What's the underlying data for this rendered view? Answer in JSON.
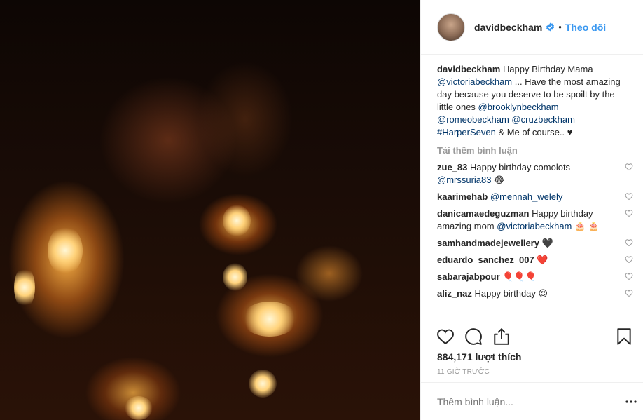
{
  "post": {
    "username": "davidbeckham",
    "follow_label": "Theo dõi",
    "dot": "•"
  },
  "caption": {
    "username": "davidbeckham",
    "text1": " Happy Birthday Mama ",
    "mention1": "@victoriabeckham",
    "text2": " ... Have the most amazing day because you deserve to be spoilt by the little ones ",
    "mention2": "@brooklynbeckham",
    "mention3": "@romeobeckham",
    "mention4": "@cruzbeckham",
    "mention5": "#HarperSeven",
    "text3": " & Me of course.. ♥"
  },
  "load_more_label": "Tải thêm bình luận",
  "comments": [
    {
      "user": "zue_83",
      "text": " Happy birthday comolots ",
      "mention": "@mrssuria83",
      "emoji": "😂"
    },
    {
      "user": "kaarimehab",
      "text": " ",
      "mention": "@mennah_welely",
      "emoji": ""
    },
    {
      "user": "danicamaedeguzman",
      "text": " Happy birthday amazing mom ",
      "mention": "@victoriabeckham",
      "emoji": "🎂 🎂"
    },
    {
      "user": "samhandmadejewellery",
      "text": " ",
      "mention": "",
      "emoji": "🖤"
    },
    {
      "user": "eduardo_sanchez_007",
      "text": " ",
      "mention": "",
      "emoji": "❤️"
    },
    {
      "user": "sabarajabpour",
      "text": " ",
      "mention": "",
      "emoji": "🎈🎈🎈"
    },
    {
      "user": "aliz_naz",
      "text": " Happy birthday ",
      "mention": "",
      "emoji": "😍"
    }
  ],
  "likes_label": "884,171 lượt thích",
  "time_label": "11 GIỜ TRƯỚC",
  "add_comment_placeholder": "Thêm bình luận...",
  "icons": {
    "like": "heart-icon",
    "comment": "comment-icon",
    "share": "share-icon",
    "save": "bookmark-icon",
    "more": "more-options-icon",
    "verified": "verified-badge-icon"
  },
  "colors": {
    "link": "#3897f0",
    "mention": "#003569",
    "muted": "#999999"
  }
}
